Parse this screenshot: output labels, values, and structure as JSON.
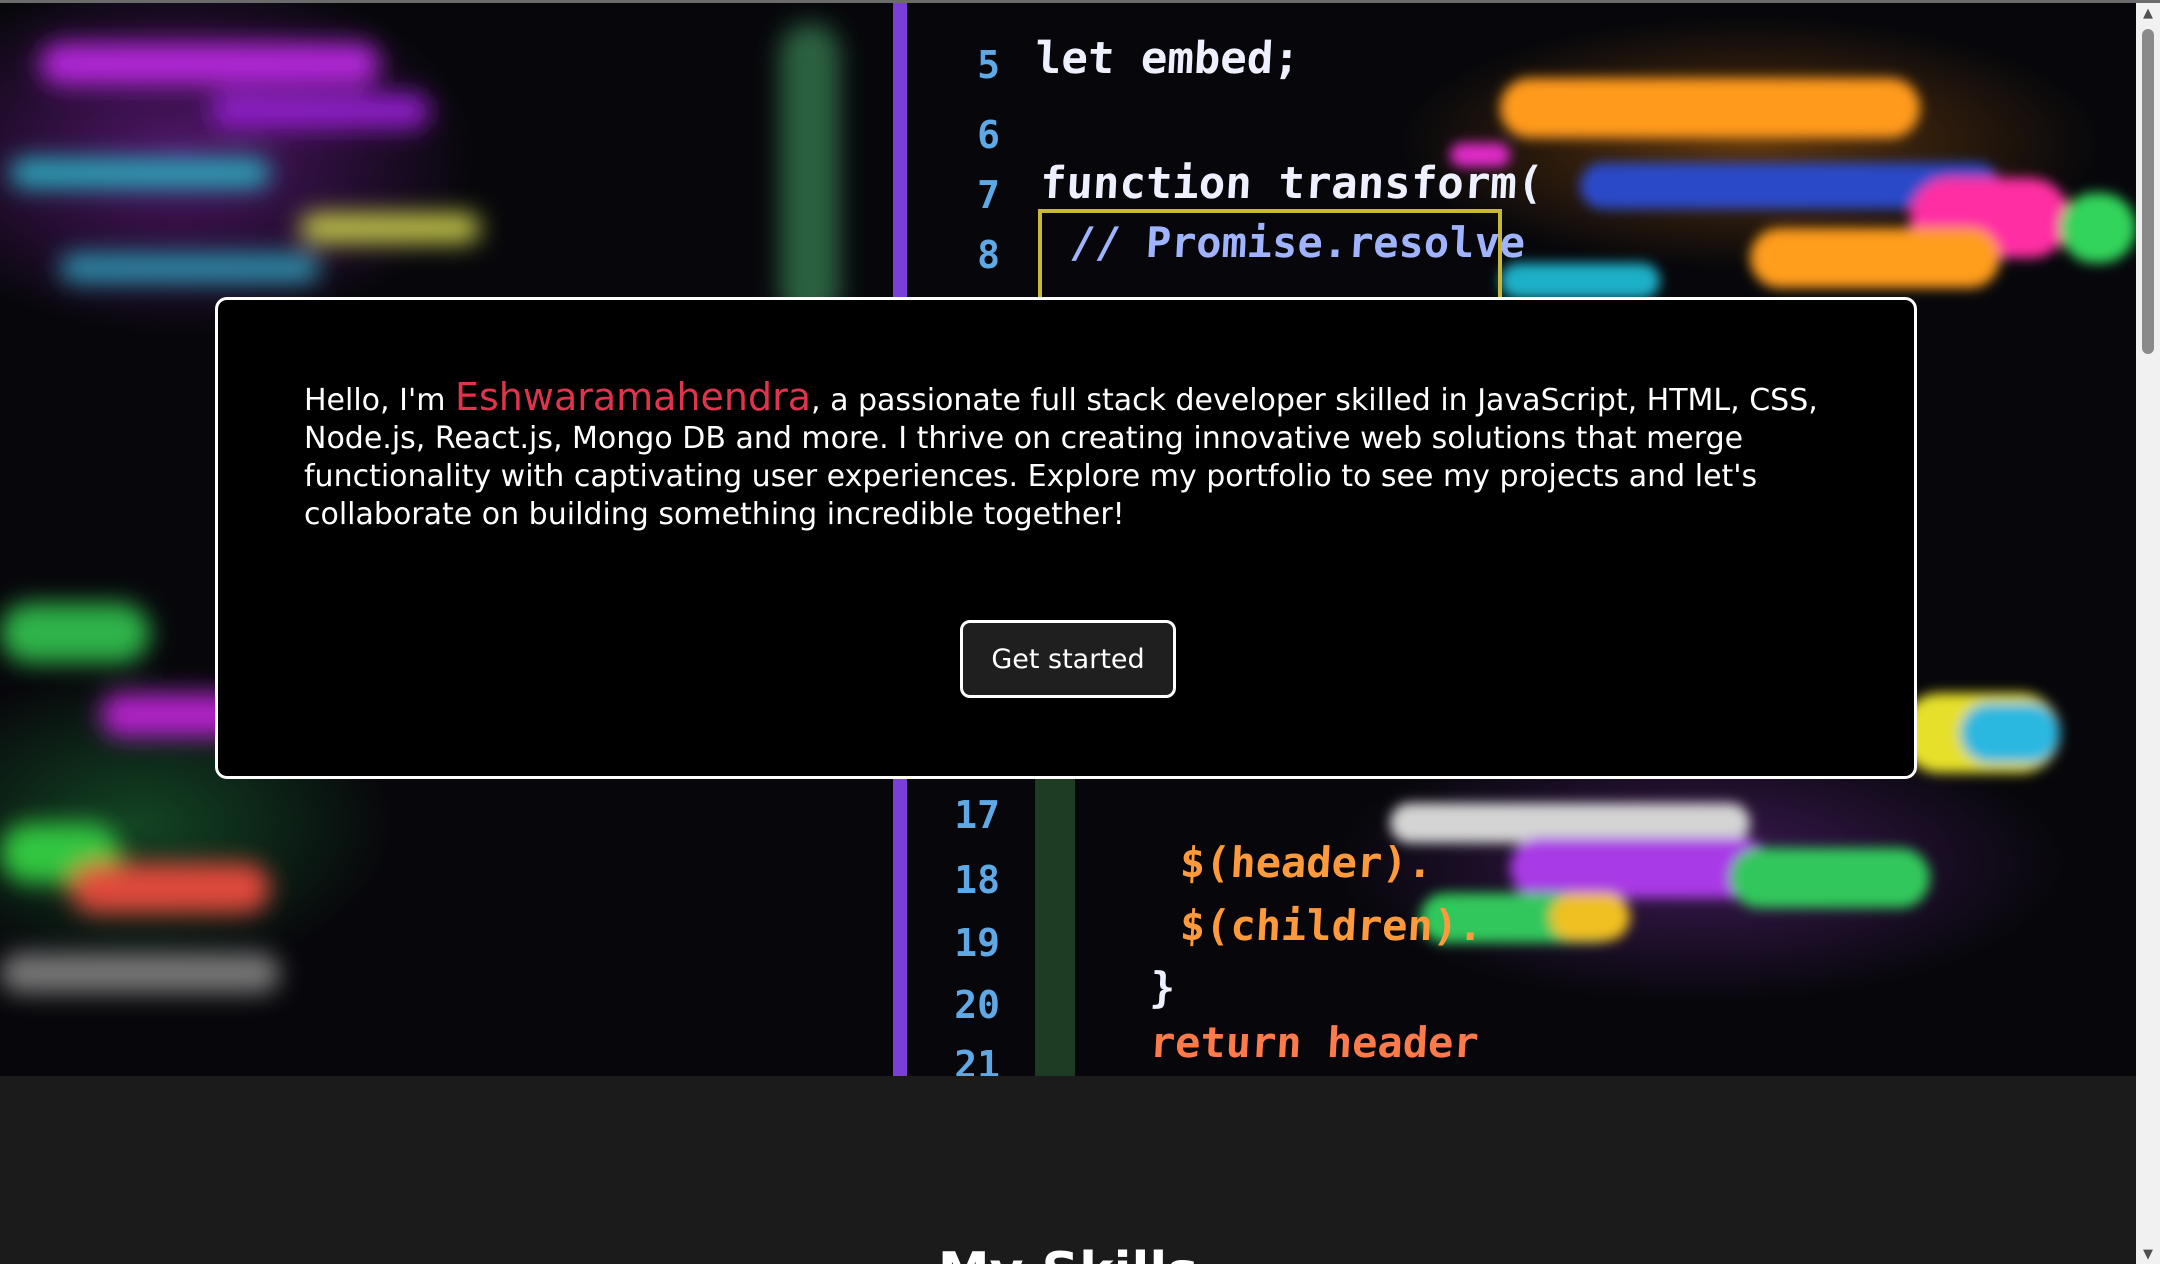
{
  "hero": {
    "code_lines": [
      {
        "num": "5",
        "text": "let embed;",
        "color": "#eef0ff"
      },
      {
        "num": "6",
        "text": "",
        "color": "#eef0ff"
      },
      {
        "num": "7",
        "text": "function transform(",
        "color": "#eef0ff"
      },
      {
        "num": "8",
        "text": "// Promise.resolve",
        "color": "#9fb3ff"
      },
      {
        "num": "17",
        "text": "",
        "color": "#ffd060"
      },
      {
        "num": "18",
        "text": "$(header).",
        "color": "#ff9a3c"
      },
      {
        "num": "19",
        "text": "$(children).",
        "color": "#ff9a3c"
      },
      {
        "num": "20",
        "text": "}",
        "color": "#eef0ff"
      },
      {
        "num": "21",
        "text": "return header",
        "color": "#ff7a4a"
      }
    ],
    "intro": {
      "prefix": "Hello, I'm ",
      "name": "Eshwaramahendra",
      "suffix": ", a passionate full stack developer skilled in JavaScript, HTML, CSS, Node.js, React.js, Mongo DB and more. I thrive on creating innovative web solutions that merge functionality with captivating user experiences. Explore my portfolio to see my projects and let's collaborate on building something incredible together!"
    },
    "cta_label": "Get started"
  },
  "skills": {
    "heading": "My Skills"
  },
  "scrollbar": {
    "up_icon": "▲",
    "down_icon": "▼"
  },
  "colors": {
    "accent": "#e0344c",
    "card_bg": "#000000",
    "section_bg": "#1b1b1b"
  }
}
